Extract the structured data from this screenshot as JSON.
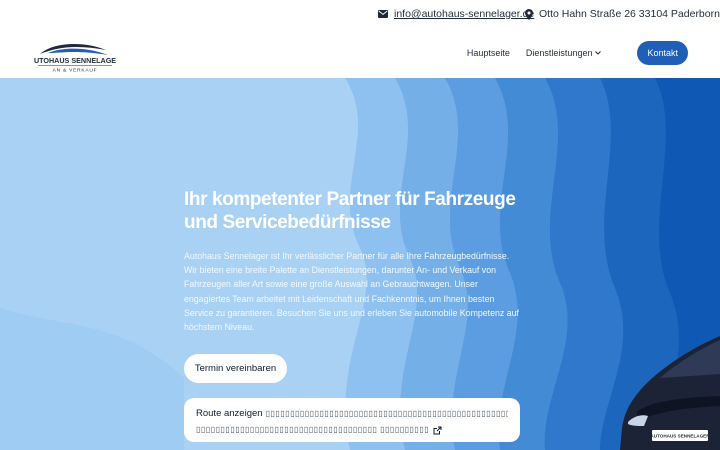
{
  "contact": {
    "email": "info@autohaus-sennelager.de",
    "address": "Otto Hahn Straße 26 33104 Paderborn"
  },
  "logo": {
    "line1": "AUTOHAUS SENNELAGER",
    "line2": "AN & VERKAUF"
  },
  "nav": {
    "home": "Hauptseite",
    "services": "Dienstleistungen",
    "contact": "Kontakt"
  },
  "hero": {
    "title": "Ihr kompetenter Partner für Fahrzeuge und Servicebedürfnisse",
    "text": "Autohaus Sennelager ist Ihr verlässlicher Partner für alle Ihre Fahrzeugbedürfnisse. Wir bieten eine breite Palette an Dienstleistungen, darunter An- und Verkauf von Fahrzeugen aller Art sowie eine große Auswahl an Gebrauchtwagen. Unser engagiertes Team arbeitet mit Leidenschaft und Fachkenntnis, um Ihnen besten Service zu garantieren. Besuchen Sie uns und erleben Sie automobile Kompetenz auf höchstem Niveau.",
    "button_primary": "Termin vereinbaren",
    "route_label": "Route anzeigen",
    "route_line1": "▯▯▯▯▯▯▯▯▯▯▯▯▯▯▯▯▯▯▯▯▯▯▯▯▯▯▯▯▯▯▯▯▯▯▯▯▯▯▯▯▯▯▯▯▯▯▯▯▯▯▯▯▯▯▯▯▯▯▯▯",
    "route_line2": "▯▯▯▯▯▯▯▯▯▯▯▯▯▯▯▯▯▯▯▯▯▯▯▯▯▯▯▯▯▯▯▯▯▯▯▯▯ ▯▯▯▯▯▯▯▯▯▯"
  },
  "car_plate": "AUTOHAUS SENNELAGER",
  "icons": {
    "mail": "envelope-icon",
    "location": "map-pin-icon",
    "chevron": "chevron-down-icon",
    "external": "external-link-icon"
  },
  "colors": {
    "accent": "#1f5fb6",
    "hero_light": "#a8d1f3",
    "hero_dark": "#0b57b8"
  }
}
